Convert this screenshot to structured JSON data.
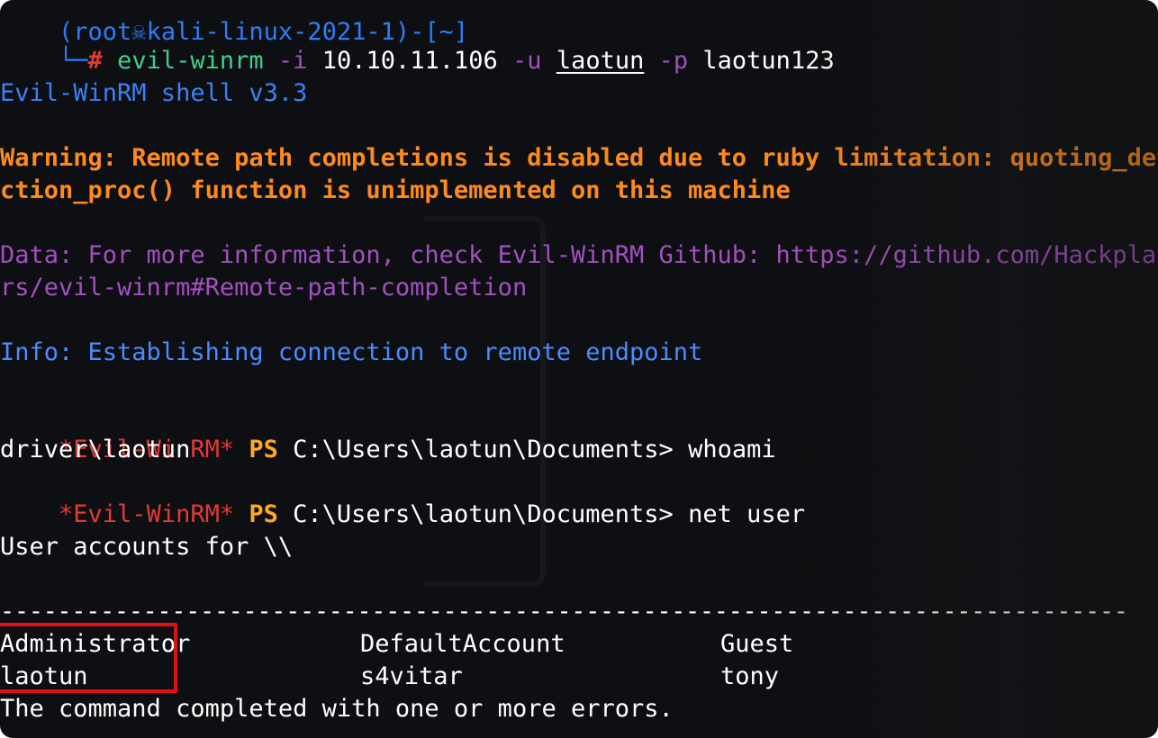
{
  "terminal": {
    "top_prompt": "(root☠kali-linux-2021-1)-[~]",
    "command_line": {
      "corner": "└─",
      "hash": "#",
      "cmd": "evil-winrm",
      "flag_i": "-i",
      "ip": "10.10.11.106",
      "flag_u": "-u",
      "user": "laotun",
      "flag_p": "-p",
      "password": "laotun123"
    },
    "banner": "Evil-WinRM shell v3.3",
    "warning_line1": "Warning: Remote path completions is disabled due to ruby limitation: quoting_dete",
    "warning_line2": "ction_proc() function is unimplemented on this machine",
    "data_line1": "Data: For more information, check Evil-WinRM Github: https://github.com/Hackplaye",
    "data_line2": "rs/evil-winrm#Remote-path-completion",
    "info_line": "Info: Establishing connection to remote endpoint",
    "session": [
      {
        "prompt_tag": "*Evil-WinRM*",
        "ps": "PS",
        "path": "C:\\Users\\laotun\\Documents>",
        "command": "whoami"
      },
      {
        "prompt_tag": "*Evil-WinRM*",
        "ps": "PS",
        "path": "C:\\Users\\laotun\\Documents>",
        "command": "net user"
      }
    ],
    "whoami_output": "driver\\laotun",
    "user_accounts_header": "User accounts for \\\\",
    "separator": "-------------------------------------------------------------------------------",
    "accounts": [
      [
        "Administrator",
        "DefaultAccount",
        "Guest"
      ],
      [
        "laotun",
        "s4vitar",
        "tony"
      ]
    ],
    "completion_line": "The command completed with one or more errors."
  },
  "colors": {
    "background": "#0d0f12",
    "blue": "#3b82f6",
    "orange": "#ff8a1c",
    "purple": "#a44fc1",
    "red": "#e53935",
    "green": "#3ecf8e",
    "highlight": "#e01010"
  }
}
